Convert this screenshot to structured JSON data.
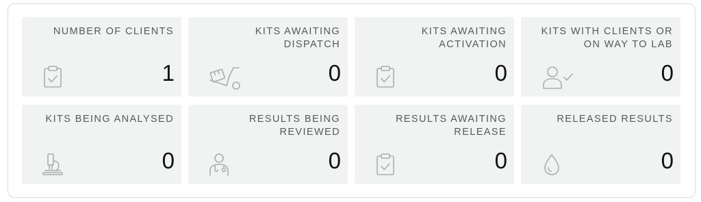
{
  "colors": {
    "card_background": "#f1f2f2",
    "label_text": "#555a5c",
    "value_text": "#111111",
    "icon_stroke": "#a9aeb0",
    "panel_border": "#dcdcdc"
  },
  "cards": [
    {
      "label": "NUMBER OF CLIENTS",
      "value": "1",
      "icon": "clipboard-check-icon"
    },
    {
      "label": "KITS AWAITING DISPATCH",
      "value": "0",
      "icon": "hand-truck-icon"
    },
    {
      "label": "KITS AWAITING ACTIVATION",
      "value": "0",
      "icon": "clipboard-check-icon"
    },
    {
      "label": "KITS WITH CLIENTS OR ON WAY TO LAB",
      "value": "0",
      "icon": "user-check-icon"
    },
    {
      "label": "KITS BEING ANALYSED",
      "value": "0",
      "icon": "microscope-icon"
    },
    {
      "label": "RESULTS BEING REVIEWED",
      "value": "0",
      "icon": "doctor-icon"
    },
    {
      "label": "RESULTS AWAITING RELEASE",
      "value": "0",
      "icon": "clipboard-check-icon"
    },
    {
      "label": "RELEASED RESULTS",
      "value": "0",
      "icon": "droplet-icon"
    }
  ]
}
